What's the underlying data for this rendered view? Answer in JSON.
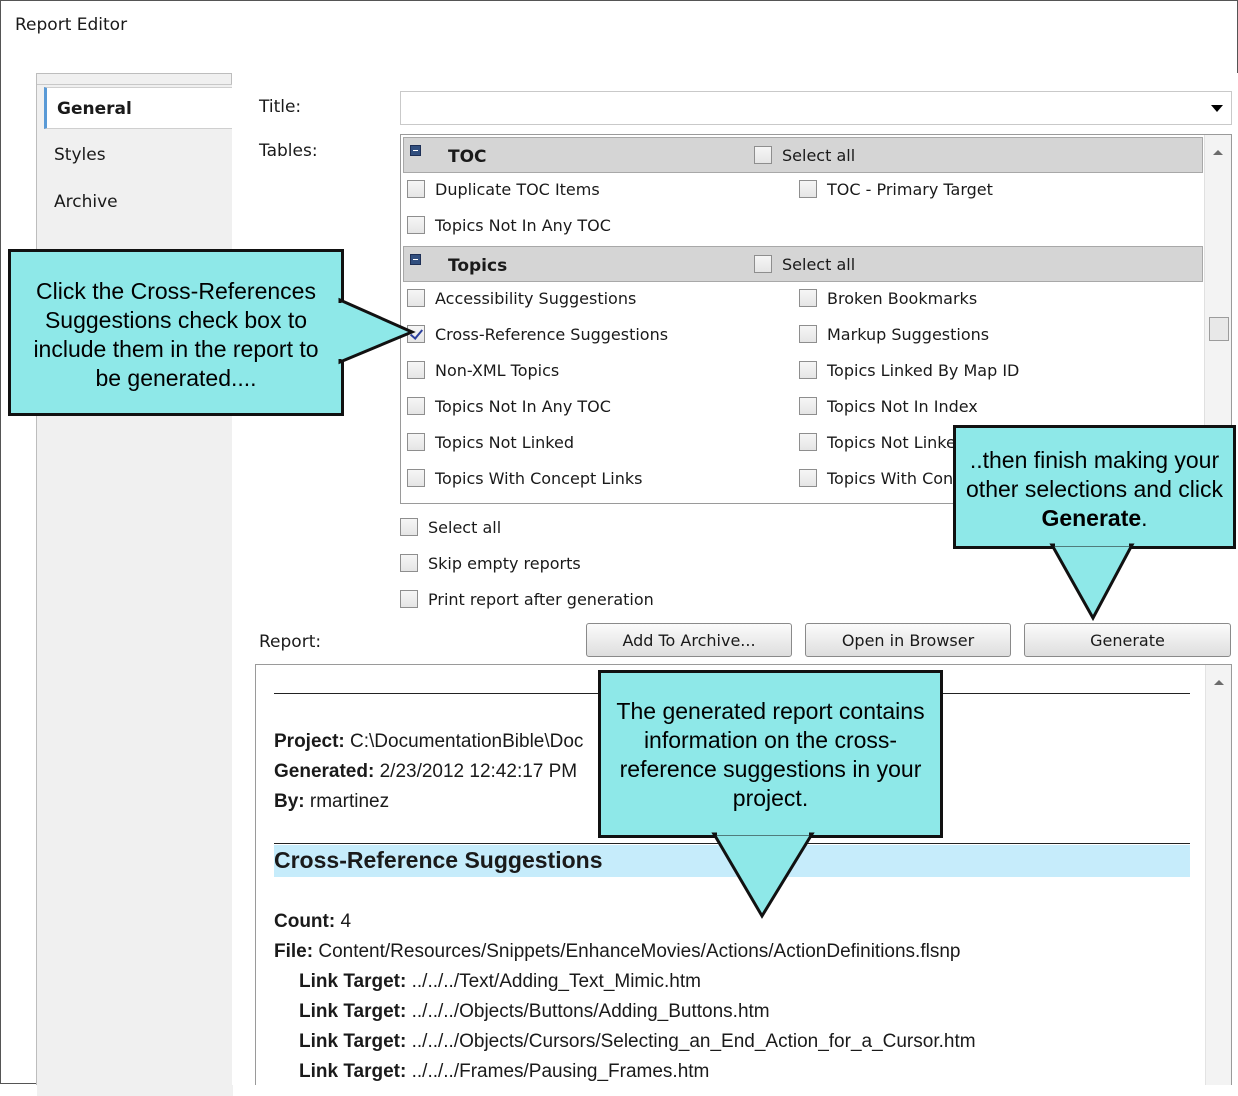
{
  "window": {
    "title": "Report Editor"
  },
  "sidebar": {
    "tabs": [
      {
        "label": "General",
        "active": true
      },
      {
        "label": "Styles",
        "active": false
      },
      {
        "label": "Archive",
        "active": false
      }
    ]
  },
  "form": {
    "title_label": "Title:",
    "title_value": "",
    "tables_label": "Tables:",
    "report_label": "Report:"
  },
  "tables": {
    "groups": [
      {
        "name": "TOC",
        "select_all_label": "Select all",
        "items": [
          {
            "label": "Duplicate TOC Items",
            "checked": false
          },
          {
            "label": "TOC - Primary Target",
            "checked": false
          },
          {
            "label": "Topics Not In Any TOC",
            "checked": false
          }
        ]
      },
      {
        "name": "Topics",
        "select_all_label": "Select all",
        "items": [
          {
            "label": "Accessibility Suggestions",
            "checked": false
          },
          {
            "label": "Broken Bookmarks",
            "checked": false
          },
          {
            "label": "Cross-Reference Suggestions",
            "checked": true
          },
          {
            "label": "Markup Suggestions",
            "checked": false
          },
          {
            "label": "Non-XML Topics",
            "checked": false
          },
          {
            "label": "Topics Linked By Map ID",
            "checked": false
          },
          {
            "label": "Topics Not In Any TOC",
            "checked": false
          },
          {
            "label": "Topics Not In Index",
            "checked": false
          },
          {
            "label": "Topics Not Linked",
            "checked": false
          },
          {
            "label": "Topics Not Linked",
            "checked": false
          },
          {
            "label": "Topics With Concept Links",
            "checked": false
          },
          {
            "label": "Topics With Conc",
            "checked": false
          }
        ]
      }
    ]
  },
  "options": {
    "select_all": "Select all",
    "skip_empty": "Skip empty reports",
    "print_after": "Print report after generation"
  },
  "buttons": {
    "add_to_archive": "Add To Archive...",
    "open_in_browser": "Open in Browser",
    "generate": "Generate"
  },
  "report": {
    "project_label": "Project:",
    "project_value": "C:\\DocumentationBible\\Doc",
    "generated_label": "Generated:",
    "generated_value": "2/23/2012 12:42:17 PM",
    "by_label": "By:",
    "by_value": "rmartinez",
    "section_title": "Cross-Reference Suggestions",
    "count_label": "Count:",
    "count_value": "4",
    "file_label": "File:",
    "file_value": "Content/Resources/Snippets/EnhanceMovies/Actions/ActionDefinitions.flsnp",
    "link_target_label": "Link Target:",
    "link_targets": [
      "../../../Text/Adding_Text_Mimic.htm",
      "../../../Objects/Buttons/Adding_Buttons.htm",
      "../../../Objects/Cursors/Selecting_an_End_Action_for_a_Cursor.htm",
      "../../../Frames/Pausing_Frames.htm"
    ]
  },
  "callouts": {
    "left": "Click the Cross-References Suggestions check box to include them in the report to be generated....",
    "right_pre": "..then finish making your other selections and click ",
    "right_bold": "Generate",
    "right_post": ".",
    "bottom": "The generated report contains information on the cross-reference suggestions in your project."
  },
  "colors": {
    "callout_fill": "#8ee8e8",
    "report_heading_fill": "#c6ecfb",
    "group_header_fill": "#d5d5d5"
  }
}
